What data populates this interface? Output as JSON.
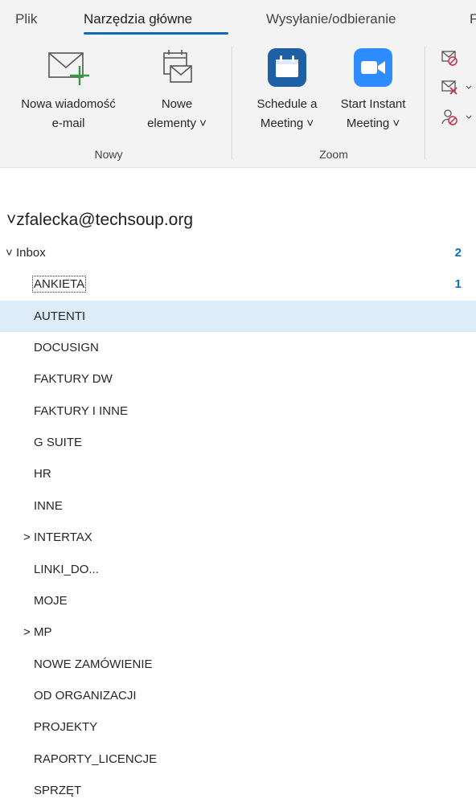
{
  "ribbon": {
    "tabs": [
      {
        "label": "Plik"
      },
      {
        "label": "Narzędzia główne"
      },
      {
        "label": "Wysyłanie/odbieranie"
      },
      {
        "label": "F"
      }
    ],
    "groups": {
      "new": {
        "label": "Nowy",
        "new_email_line1": "Nowa wiadomość",
        "new_email_line2": "e-mail",
        "new_items_line1": "Nowe",
        "new_items_line2": "elementy ˅"
      },
      "zoom": {
        "label": "Zoom",
        "schedule_line1": "Schedule a",
        "schedule_line2": "Meeting ˅",
        "instant_line1": "Start Instant",
        "instant_line2": "Meeting ˅"
      }
    }
  },
  "account": {
    "email": "zfalecka@techsoup.org"
  },
  "folders": [
    {
      "label": "Inbox",
      "count": "2",
      "expander": "˅"
    },
    {
      "label": "ANKIETA",
      "count": "1"
    },
    {
      "label": "AUTENTI",
      "count": ""
    },
    {
      "label": "DOCUSIGN",
      "count": ""
    },
    {
      "label": "FAKTURY DW",
      "count": ""
    },
    {
      "label": "FAKTURY I INNE",
      "count": ""
    },
    {
      "label": "G SUITE",
      "count": ""
    },
    {
      "label": "HR",
      "count": ""
    },
    {
      "label": "INNE",
      "count": ""
    },
    {
      "label": "INTERTAX",
      "count": "",
      "expander": ">"
    },
    {
      "label": "LINKI_DO...",
      "count": ""
    },
    {
      "label": "MOJE",
      "count": ""
    },
    {
      "label": "MP",
      "count": "",
      "expander": ">"
    },
    {
      "label": "NOWE ZAMÓWIENIE",
      "count": ""
    },
    {
      "label": "OD ORGANIZACJI",
      "count": ""
    },
    {
      "label": "PROJEKTY",
      "count": ""
    },
    {
      "label": "RAPORTY_LICENCJE",
      "count": ""
    },
    {
      "label": "SPRZĘT",
      "count": ""
    }
  ],
  "colors": {
    "accent": "#0f6cbd",
    "zoom_blue": "#2d8cff",
    "calendar_blue": "#1f5fa6",
    "selected": "#deecf9"
  }
}
